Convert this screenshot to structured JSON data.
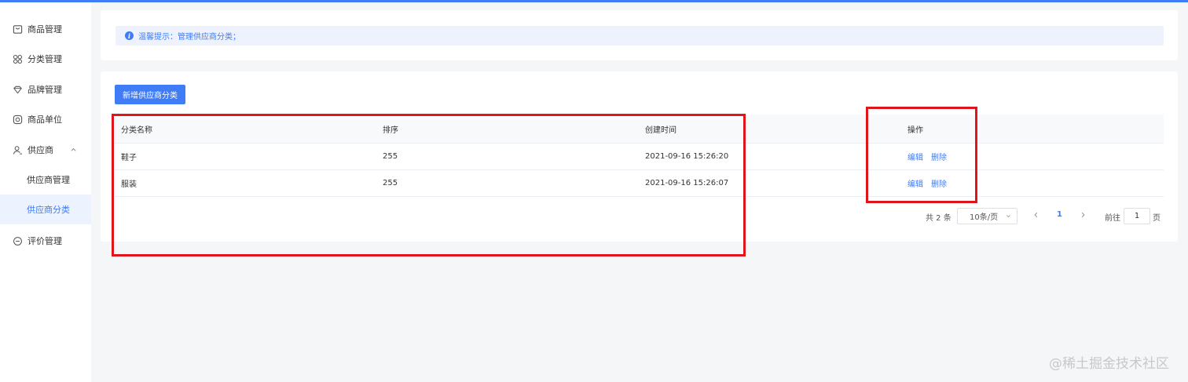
{
  "colors": {
    "primary": "#3f7cf6",
    "highlight": "#e0151b",
    "tip_bg": "#edf2fd"
  },
  "sidebar": {
    "items": [
      {
        "label": "商品管理",
        "icon": "box-icon"
      },
      {
        "label": "分类管理",
        "icon": "grid-icon"
      },
      {
        "label": "品牌管理",
        "icon": "diamond-icon"
      },
      {
        "label": "商品单位",
        "icon": "camera-icon"
      },
      {
        "label": "供应商",
        "icon": "user-icon",
        "expanded": true
      },
      {
        "label": "供应商管理"
      },
      {
        "label": "供应商分类",
        "active": true
      },
      {
        "label": "评价管理",
        "icon": "chat-icon"
      }
    ]
  },
  "tip": {
    "text": "温馨提示：管理供应商分类；",
    "icon": "info-icon"
  },
  "toolbar": {
    "add_label": "新增供应商分类"
  },
  "table": {
    "columns": [
      "分类名称",
      "排序",
      "创建时间",
      "操作"
    ],
    "rows": [
      {
        "name": "鞋子",
        "sort": "255",
        "created": "2021-09-16 15:26:20",
        "edit": "编辑",
        "delete": "删除"
      },
      {
        "name": "服装",
        "sort": "255",
        "created": "2021-09-16 15:26:07",
        "edit": "编辑",
        "delete": "删除"
      }
    ]
  },
  "pagination": {
    "total": "共 2 条",
    "page_size": "10条/页",
    "current_page": "1",
    "goto_label": "前往",
    "goto_value": "1",
    "goto_suffix": "页"
  },
  "watermark": "@稀土掘金技术社区"
}
